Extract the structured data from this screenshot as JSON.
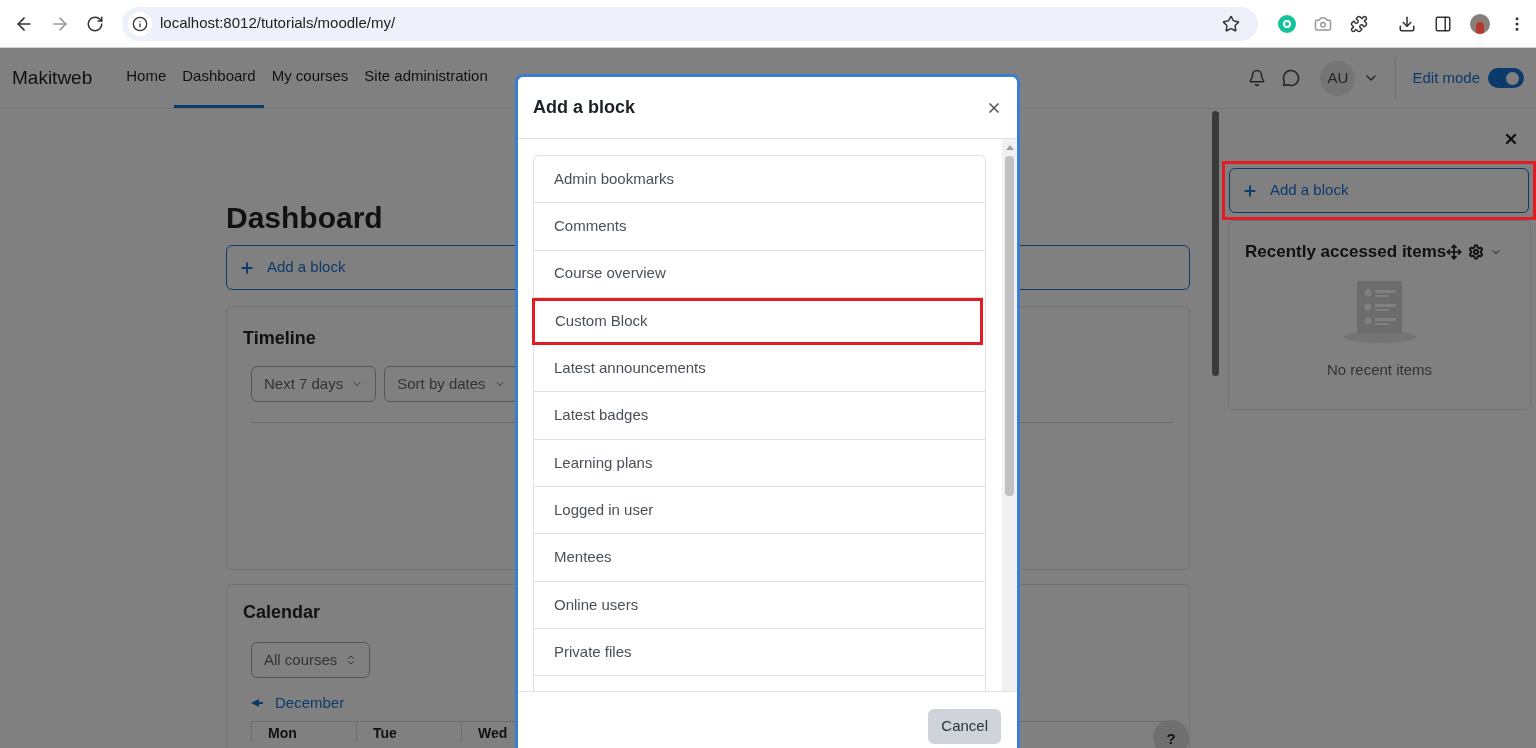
{
  "browser": {
    "url": "localhost:8012/tutorials/moodle/my/"
  },
  "navbar": {
    "brand": "Makitweb",
    "items": [
      {
        "label": "Home",
        "selected": false
      },
      {
        "label": "Dashboard",
        "selected": true
      },
      {
        "label": "My courses",
        "selected": false
      },
      {
        "label": "Site administration",
        "selected": false
      }
    ],
    "avatar": "AU",
    "edit_mode": {
      "label": "Edit mode",
      "on": true
    }
  },
  "main": {
    "title": "Dashboard",
    "add_block": "Add a block",
    "timeline": {
      "title": "Timeline",
      "filters": [
        "Next 7 days",
        "Sort by dates"
      ]
    },
    "calendar": {
      "title": "Calendar",
      "course_filter": "All courses",
      "month_link": "December",
      "columns": [
        "Mon",
        "Tue",
        "Wed"
      ]
    }
  },
  "drawer": {
    "add_block": {
      "label": "Add a block",
      "highlighted": true
    },
    "block": {
      "title": "Recently accessed items",
      "empty": "No recent items"
    }
  },
  "help_button": "?",
  "modal": {
    "title": "Add a block",
    "items": [
      {
        "label": "Admin bookmarks",
        "highlighted": false
      },
      {
        "label": "Comments",
        "highlighted": false
      },
      {
        "label": "Course overview",
        "highlighted": false
      },
      {
        "label": "Custom Block",
        "highlighted": true
      },
      {
        "label": "Latest announcements",
        "highlighted": false
      },
      {
        "label": "Latest badges",
        "highlighted": false
      },
      {
        "label": "Learning plans",
        "highlighted": false
      },
      {
        "label": "Logged in user",
        "highlighted": false
      },
      {
        "label": "Mentees",
        "highlighted": false
      },
      {
        "label": "Online users",
        "highlighted": false
      },
      {
        "label": "Private files",
        "highlighted": false
      }
    ],
    "cancel": "Cancel"
  }
}
